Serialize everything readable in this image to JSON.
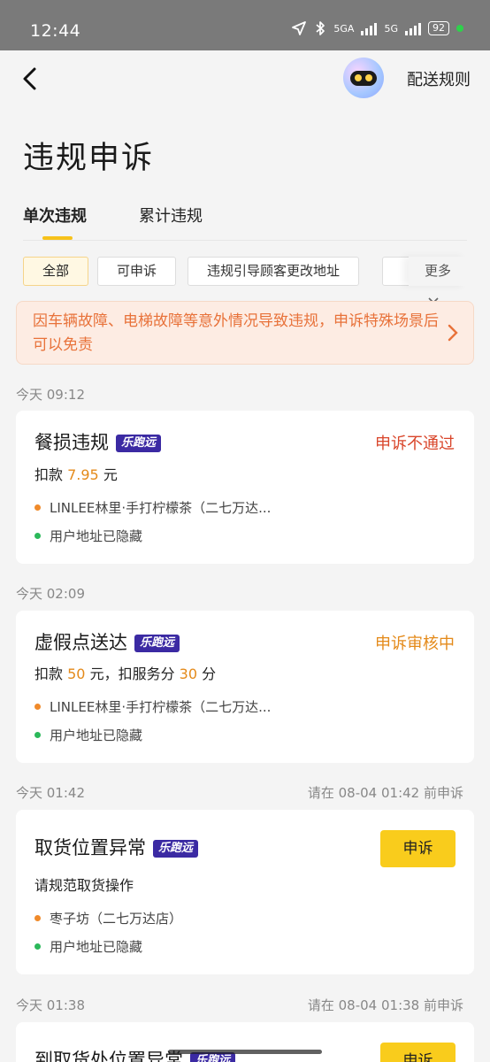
{
  "status_bar": {
    "time": "12:44",
    "net1": "5GA",
    "net2": "5G",
    "battery": "92"
  },
  "header": {
    "rules_label": "配送规则"
  },
  "page": {
    "title": "违规申诉"
  },
  "tabs": [
    "单次违规",
    "累计违规"
  ],
  "filters": {
    "chips": [
      "全部",
      "可申诉",
      "违规引导顾客更改地址"
    ],
    "more_label": "更多"
  },
  "notice": {
    "text": "因车辆故障、电梯故障等意外情况导致违规，申诉特殊场景后可以免责"
  },
  "records": [
    {
      "date": "今天 09:12",
      "deadline": "",
      "title": "餐损违规",
      "badge": "乐跑远",
      "status": "申诉不通过",
      "status_color": "#d9462b",
      "deduction_prefix": "扣款",
      "amount": "7.95",
      "amount_unit": "元",
      "shop": "LINLEE林里·手打柠檬茶（二七万达...",
      "address": "用户地址已隐藏"
    },
    {
      "date": "今天 02:09",
      "deadline": "",
      "title": "虚假点送达",
      "badge": "乐跑远",
      "status": "申诉审核中",
      "status_color": "#e48a1a",
      "deduction_prefix": "扣款",
      "amount": "50",
      "amount_unit": "元，扣服务分",
      "score": "30",
      "score_unit": "分",
      "shop": "LINLEE林里·手打柠檬茶（二七万达...",
      "address": "用户地址已隐藏"
    },
    {
      "date": "今天 01:42",
      "deadline": "请在 08-04 01:42 前申诉",
      "title": "取货位置异常",
      "badge": "乐跑远",
      "action": "申诉",
      "description": "请规范取货操作",
      "shop": "枣子坊（二七万达店）",
      "address": "用户地址已隐藏"
    },
    {
      "date": "今天 01:38",
      "deadline": "请在 08-04 01:38 前申诉",
      "title": "到取货处位置异常",
      "badge": "乐跑远",
      "action": "申诉"
    }
  ]
}
